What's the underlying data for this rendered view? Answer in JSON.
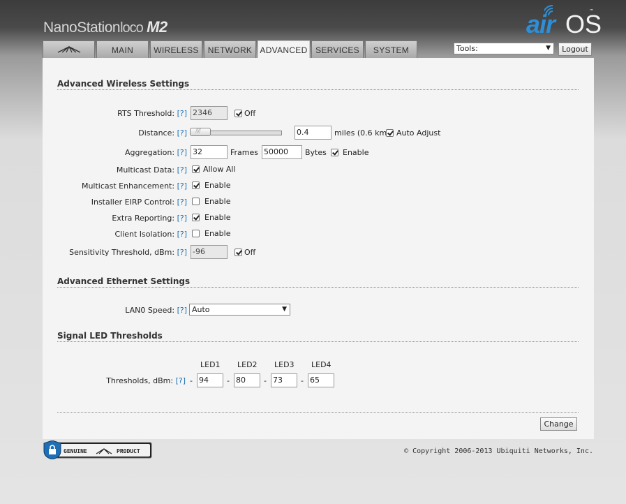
{
  "header": {
    "product_name": "NanoStation",
    "product_sub": "loco",
    "product_model": "M2",
    "logo_air": "air",
    "logo_os": "OS",
    "logo_tm": "™"
  },
  "tabs": [
    {
      "label": "",
      "icon": "ubiquiti-logo-icon"
    },
    {
      "label": "MAIN"
    },
    {
      "label": "WIRELESS"
    },
    {
      "label": "NETWORK"
    },
    {
      "label": "ADVANCED",
      "active": true
    },
    {
      "label": "SERVICES"
    },
    {
      "label": "SYSTEM"
    }
  ],
  "tools": {
    "selected": "Tools:",
    "arrow": "▼"
  },
  "logout_label": "Logout",
  "help": "[?]",
  "wireless": {
    "title": "Advanced Wireless Settings",
    "rts": {
      "label": "RTS Threshold:",
      "value": "2346",
      "off_label": "Off",
      "off_checked": true
    },
    "distance": {
      "label": "Distance:",
      "value": "0.4",
      "unit": "miles (0.6 km)",
      "auto_label": "Auto Adjust",
      "auto_checked": true,
      "slider_level": 0.0
    },
    "aggregation": {
      "label": "Aggregation:",
      "frames": "32",
      "frames_label": "Frames",
      "bytes": "50000",
      "bytes_label": "Bytes",
      "enable_label": "Enable",
      "enable_checked": true
    },
    "multicast_data": {
      "label": "Multicast Data:",
      "option": "Allow All",
      "checked": true
    },
    "multicast_enh": {
      "label": "Multicast Enhancement:",
      "option": "Enable",
      "checked": true
    },
    "eirp": {
      "label": "Installer EIRP Control:",
      "option": "Enable",
      "checked": false
    },
    "extra_reporting": {
      "label": "Extra Reporting:",
      "option": "Enable",
      "checked": true
    },
    "client_isolation": {
      "label": "Client Isolation:",
      "option": "Enable",
      "checked": false
    },
    "sensitivity": {
      "label": "Sensitivity Threshold, dBm:",
      "value": "-96",
      "off_label": "Off",
      "off_checked": true
    }
  },
  "ethernet": {
    "title": "Advanced Ethernet Settings",
    "lan0": {
      "label": "LAN0 Speed:",
      "selected": "Auto",
      "arrow": "▼"
    }
  },
  "led": {
    "title": "Signal LED Thresholds",
    "label": "Thresholds, dBm:",
    "headers": [
      "LED1",
      "LED2",
      "LED3",
      "LED4"
    ],
    "values": [
      "94",
      "80",
      "73",
      "65"
    ],
    "dash": "-"
  },
  "change_label": "Change",
  "footer": {
    "genuine_left": "GENUINE",
    "genuine_right": "PRODUCT",
    "copyright": "© Copyright 2006-2013 Ubiquiti Networks, Inc."
  }
}
